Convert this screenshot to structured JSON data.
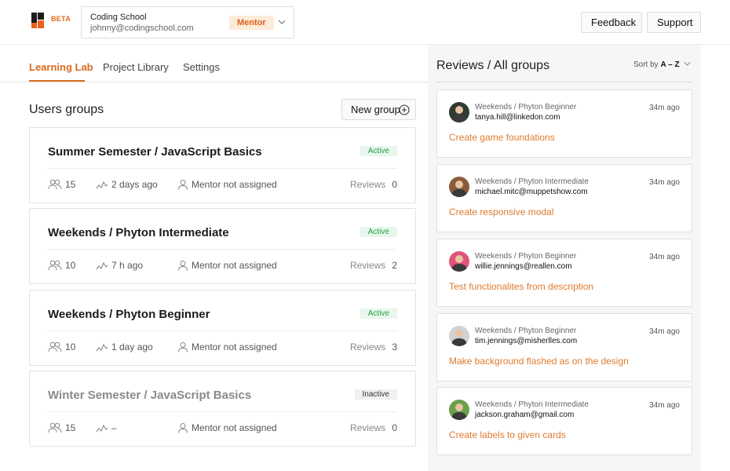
{
  "header": {
    "beta": "BETA",
    "org_name": "Coding School",
    "org_email": "johnny@codingschool.com",
    "role": "Mentor",
    "feedback_label": "Feedback",
    "support_label": "Support"
  },
  "tabs": [
    {
      "label": "Learning Lab",
      "active": true
    },
    {
      "label": "Project Library",
      "active": false
    },
    {
      "label": "Settings",
      "active": false
    }
  ],
  "groups_section": {
    "title": "Users groups",
    "new_group_label": "New group"
  },
  "groups": [
    {
      "name": "Summer Semester / JavaScript Basics",
      "status": "Active",
      "users": "15",
      "activity": "2 days ago",
      "mentor": "Mentor not assigned",
      "reviews_label": "Reviews",
      "reviews": "0"
    },
    {
      "name": "Weekends / Phyton Intermediate",
      "status": "Active",
      "users": "10",
      "activity": "7 h ago",
      "mentor": "Mentor not assigned",
      "reviews_label": "Reviews",
      "reviews": "2"
    },
    {
      "name": "Weekends / Phyton Beginner",
      "status": "Active",
      "users": "10",
      "activity": "1 day ago",
      "mentor": "Mentor not assigned",
      "reviews_label": "Reviews",
      "reviews": "3"
    },
    {
      "name": "Winter Semester / JavaScript Basics",
      "status": "Inactive",
      "users": "15",
      "activity": "–",
      "mentor": "Mentor not assigned",
      "reviews_label": "Reviews",
      "reviews": "0"
    }
  ],
  "reviews_section": {
    "title": "Reviews / All groups",
    "sort_prefix": "Sort by",
    "sort_value": "A – Z"
  },
  "reviews": [
    {
      "group": "Weekends / Phyton Beginner",
      "email": "tanya.hill@linkedon.com",
      "time": "34m ago",
      "task": "Create game foundations",
      "avatar_color": "#2f3b2f"
    },
    {
      "group": "Weekends / Phyton Intermediate",
      "email": "michael.mitc@muppetshow.com",
      "time": "34m ago",
      "task": "Create responsive modal",
      "avatar_color": "#8a5a3a"
    },
    {
      "group": "Weekends / Phyton Beginner",
      "email": "willie.jennings@reallen.com",
      "time": "34m ago",
      "task": "Test functionalites from description",
      "avatar_color": "#e0537a"
    },
    {
      "group": "Weekends / Phyton Beginner",
      "email": "tim.jennings@misherlles.com",
      "time": "34m ago",
      "task": "Make background flashed as on the design",
      "avatar_color": "#cfd3d6"
    },
    {
      "group": "Weekends / Phyton Intermediate",
      "email": "jackson.graham@gmail.com",
      "time": "34m ago",
      "task": "Create labels to given cards",
      "avatar_color": "#6aa04a"
    }
  ],
  "colors": {
    "accent": "#dc6a1e",
    "active_badge": "#23a04a",
    "task_link": "#de7b2e"
  }
}
